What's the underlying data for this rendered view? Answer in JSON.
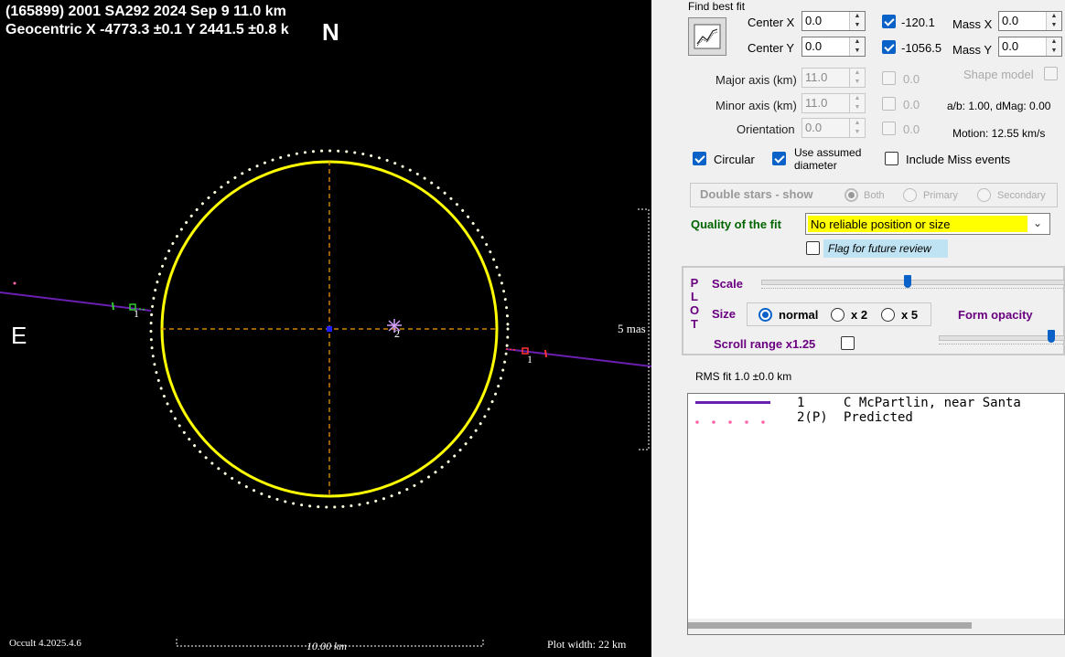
{
  "plot": {
    "title_line1": "(165899) 2001 SA292  2024 Sep 9   11.0 km",
    "title_line2": "Geocentric  X  -4773.3 ±0.1  Y 2441.5 ±0.8 k",
    "north_label": "N",
    "east_label": "E",
    "scale_mas": "5 mas",
    "version": "Occult 4.2025.4.6",
    "scale_bar_label": "10.00 km",
    "plot_width": "Plot width: 22 km",
    "chord1_label_left": "1",
    "chord1_label_right": "1",
    "star2_label": "2",
    "colors": {
      "ellipse": "#ffff00",
      "predicted": "#ffffff",
      "chord": "#6a1fb0",
      "axes": "#ff9900",
      "center": "#0000ff"
    }
  },
  "fit": {
    "find_best_fit_label": "Find best fit",
    "center_x_label": "Center X",
    "center_x_value": "0.0",
    "center_y_label": "Center Y",
    "center_y_value": "0.0",
    "center_x_check_value": "-120.1",
    "center_y_check_value": "-1056.5",
    "mass_x_label": "Mass X",
    "mass_x_value": "0.0",
    "mass_y_label": "Mass Y",
    "mass_y_value": "0.0",
    "major_axis_label": "Major axis (km)",
    "major_axis_value": "11.0",
    "major_axis_check_value": "0.0",
    "minor_axis_label": "Minor axis (km)",
    "minor_axis_value": "11.0",
    "minor_axis_check_value": "0.0",
    "orientation_label": "Orientation",
    "orientation_value": "0.0",
    "orientation_check_value": "0.0",
    "shape_model_label": "Shape model",
    "ab_dmag": "a/b: 1.00, dMag: 0.00",
    "motion": "Motion: 12.55 km/s",
    "circular_label": "Circular",
    "use_assumed_label_1": "Use assumed",
    "use_assumed_label_2": "diameter",
    "include_miss_label": "Include Miss events"
  },
  "double_stars": {
    "label": "Double stars - show",
    "both": "Both",
    "primary": "Primary",
    "secondary": "Secondary"
  },
  "quality": {
    "label": "Quality of the fit",
    "value": "No reliable position or size",
    "flag_label": "Flag for future review"
  },
  "plot_ctrl": {
    "vertical_label": [
      "P",
      "L",
      "O",
      "T"
    ],
    "scale_label": "Scale",
    "size_label": "Size",
    "size_normal": "normal",
    "size_x2": "x 2",
    "size_x5": "x 5",
    "form_opacity_label": "Form opacity",
    "scroll_range_label": "Scroll range x1.25"
  },
  "rms": "RMS fit 1.0 ±0.0 km",
  "legend": [
    {
      "num": "1",
      "name": "C McPartlin, near Santa"
    },
    {
      "num": "2(P)",
      "name": "Predicted"
    }
  ]
}
